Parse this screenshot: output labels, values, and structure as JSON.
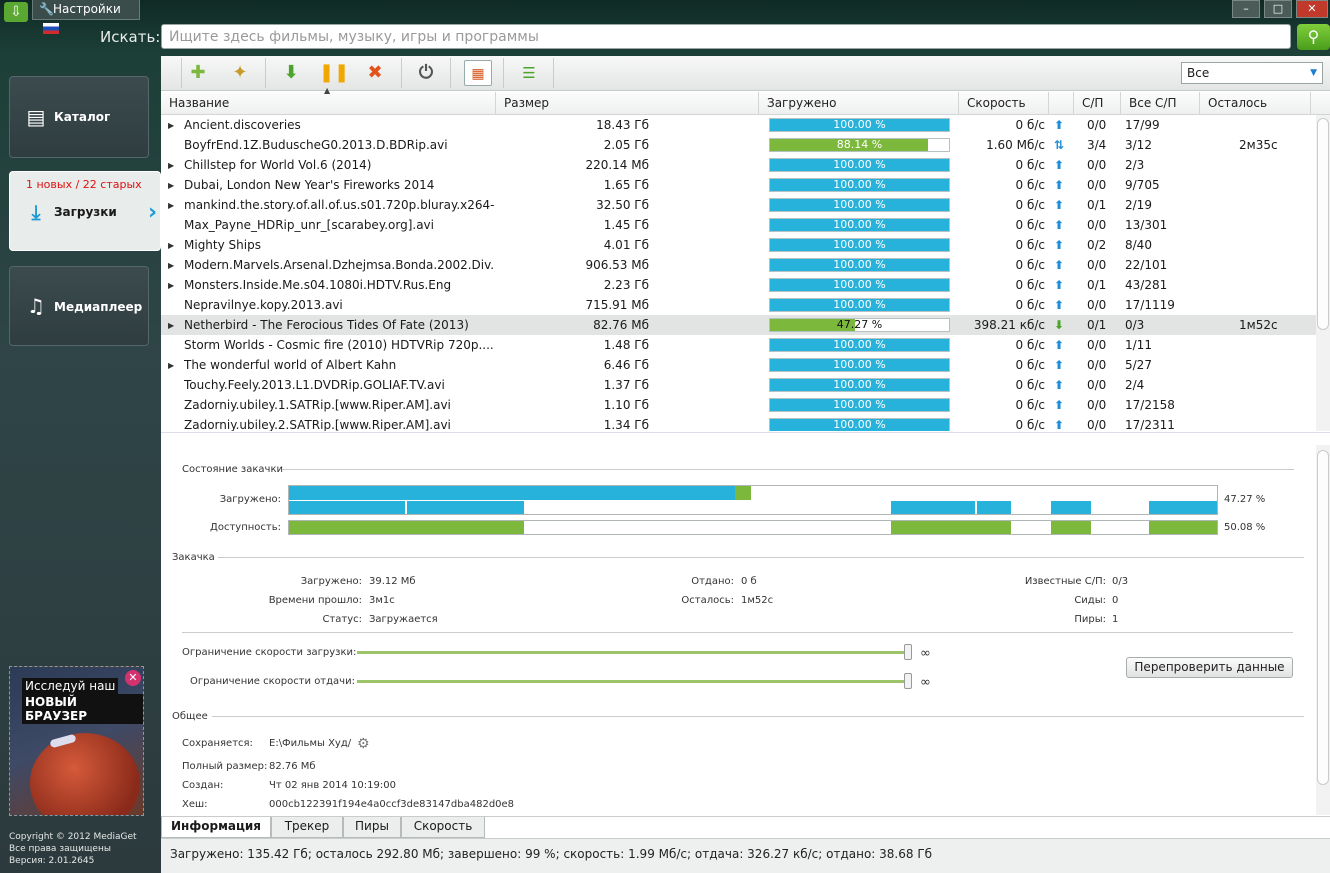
{
  "titlebar": {
    "settings_label": "Настройки",
    "minimize": "–",
    "maximize": "□",
    "close": "✕"
  },
  "search": {
    "label": "Искать:",
    "placeholder": "Ищите здесь фильмы, музыку, игры и программы"
  },
  "sidebar": {
    "catalog": "Каталог",
    "downloads": "Загрузки",
    "downloads_count": "1 новых / 22 старых",
    "media": "Медиаплеер"
  },
  "ad": {
    "line1": "Исследуй наш",
    "line2": "НОВЫЙ БРАУЗЕР"
  },
  "copyright": {
    "line1": "Copyright © 2012 MediaGet",
    "line2": "Все права защищены",
    "line3": "Версия: 2.01.2645"
  },
  "toolbar": {
    "filter_value": "Все"
  },
  "table": {
    "headers": {
      "name": "Название",
      "size": "Размер",
      "loaded": "Загружено",
      "speed": "Скорость",
      "sp": "С/П",
      "all_sp": "Все С/П",
      "remaining": "Осталось"
    },
    "rows": [
      {
        "expand": "▶",
        "name": "Ancient.discoveries",
        "size": "18.43 Гб",
        "progress": 100,
        "progress_label": "100.00 %",
        "speed": "0 б/с",
        "dir": "up",
        "sp": "0/0",
        "all_sp": "17/99",
        "remaining": ""
      },
      {
        "expand": "",
        "name": "BoyfrEnd.1Z.BuduscheG0.2013.D.BDRip.avi",
        "size": "2.05 Гб",
        "progress": 88.14,
        "progress_label": "88.14 %",
        "speed": "1.60 Мб/с",
        "dir": "both",
        "sp": "3/4",
        "all_sp": "3/12",
        "remaining": "2м35с"
      },
      {
        "expand": "▶",
        "name": "Chillstep for World Vol.6 (2014)",
        "size": "220.14 Мб",
        "progress": 100,
        "progress_label": "100.00 %",
        "speed": "0 б/с",
        "dir": "up",
        "sp": "0/0",
        "all_sp": "2/3",
        "remaining": ""
      },
      {
        "expand": "▶",
        "name": "Dubai, London New Year's Fireworks 2014",
        "size": "1.65 Гб",
        "progress": 100,
        "progress_label": "100.00 %",
        "speed": "0 б/с",
        "dir": "up",
        "sp": "0/0",
        "all_sp": "9/705",
        "remaining": ""
      },
      {
        "expand": "▶",
        "name": "mankind.the.story.of.all.of.us.s01.720p.bluray.x264-...",
        "size": "32.50 Гб",
        "progress": 100,
        "progress_label": "100.00 %",
        "speed": "0 б/с",
        "dir": "up",
        "sp": "0/1",
        "all_sp": "2/19",
        "remaining": ""
      },
      {
        "expand": "",
        "name": "Max_Payne_HDRip_unr_[scarabey.org].avi",
        "size": "1.45 Гб",
        "progress": 100,
        "progress_label": "100.00 %",
        "speed": "0 б/с",
        "dir": "up",
        "sp": "0/0",
        "all_sp": "13/301",
        "remaining": ""
      },
      {
        "expand": "▶",
        "name": "Mighty Ships",
        "size": "4.01 Гб",
        "progress": 100,
        "progress_label": "100.00 %",
        "speed": "0 б/с",
        "dir": "up",
        "sp": "0/2",
        "all_sp": "8/40",
        "remaining": ""
      },
      {
        "expand": "▶",
        "name": "Modern.Marvels.Arsenal.Dzhejmsa.Bonda.2002.Div...",
        "size": "906.53 Мб",
        "progress": 100,
        "progress_label": "100.00 %",
        "speed": "0 б/с",
        "dir": "up",
        "sp": "0/0",
        "all_sp": "22/101",
        "remaining": ""
      },
      {
        "expand": "▶",
        "name": "Monsters.Inside.Me.s04.1080i.HDTV.Rus.Eng",
        "size": "2.23 Гб",
        "progress": 100,
        "progress_label": "100.00 %",
        "speed": "0 б/с",
        "dir": "up",
        "sp": "0/1",
        "all_sp": "43/281",
        "remaining": ""
      },
      {
        "expand": "",
        "name": "Nepravilnye.kopy.2013.avi",
        "size": "715.91 Мб",
        "progress": 100,
        "progress_label": "100.00 %",
        "speed": "0 б/с",
        "dir": "up",
        "sp": "0/0",
        "all_sp": "17/1119",
        "remaining": ""
      },
      {
        "expand": "▶",
        "name": "Netherbird - The Ferocious Tides Of Fate (2013)",
        "size": "82.76 Мб",
        "progress": 47.27,
        "progress_label": "47.27 %",
        "speed": "398.21 кб/с",
        "dir": "down",
        "sp": "0/1",
        "all_sp": "0/3",
        "remaining": "1м52с",
        "selected": true
      },
      {
        "expand": "",
        "name": "Storm Worlds - Cosmic fire (2010) HDTVRip 720p....",
        "size": "1.48 Гб",
        "progress": 100,
        "progress_label": "100.00 %",
        "speed": "0 б/с",
        "dir": "up",
        "sp": "0/0",
        "all_sp": "1/11",
        "remaining": ""
      },
      {
        "expand": "▶",
        "name": "The wonderful world of Albert Kahn",
        "size": "6.46 Гб",
        "progress": 100,
        "progress_label": "100.00 %",
        "speed": "0 б/с",
        "dir": "up",
        "sp": "0/0",
        "all_sp": "5/27",
        "remaining": ""
      },
      {
        "expand": "",
        "name": "Touchy.Feely.2013.L1.DVDRip.GOLIAF.TV.avi",
        "size": "1.37 Гб",
        "progress": 100,
        "progress_label": "100.00 %",
        "speed": "0 б/с",
        "dir": "up",
        "sp": "0/0",
        "all_sp": "2/4",
        "remaining": ""
      },
      {
        "expand": "",
        "name": "Zadorniy.ubiley.1.SATRip.[www.Riper.AM].avi",
        "size": "1.10 Гб",
        "progress": 100,
        "progress_label": "100.00 %",
        "speed": "0 б/с",
        "dir": "up",
        "sp": "0/0",
        "all_sp": "17/2158",
        "remaining": ""
      },
      {
        "expand": "",
        "name": "Zadorniy.ubiley.2.SATRip.[www.Riper.AM].avi",
        "size": "1.34 Гб",
        "progress": 100,
        "progress_label": "100.00 %",
        "speed": "0 б/с",
        "dir": "up",
        "sp": "0/0",
        "all_sp": "17/2311",
        "remaining": ""
      }
    ]
  },
  "details": {
    "state_title": "Состояние закачки",
    "loaded_label": "Загружено:",
    "loaded_pct": "47.27 %",
    "avail_label": "Доступность:",
    "avail_pct": "50.08 %",
    "download_title": "Закачка",
    "dl_loaded_label": "Загружено:",
    "dl_loaded": "39.12 Мб",
    "elapsed_label": "Времени прошло:",
    "elapsed": "3м1с",
    "status_label": "Статус:",
    "status": "Загружается",
    "given_label": "Отдано:",
    "given": "0 б",
    "remaining_label": "Осталось:",
    "remaining": "1м52с",
    "known_label": "Известные С/П:",
    "known": "0/3",
    "seeds_label": "Сиды:",
    "seeds": "0",
    "peers_label": "Пиры:",
    "peers": "1",
    "dl_limit_label": "Ограничение скорости загрузки:",
    "ul_limit_label": "Ограничение скорости отдачи:",
    "infinity": "∞",
    "recheck": "Перепроверить данные",
    "general_title": "Общее",
    "saved_label": "Сохраняется:",
    "saved": "E:\\Фильмы Худ/",
    "full_size_label": "Полный размер:",
    "full_size": "82.76 Мб",
    "created_label": "Создан:",
    "created": "Чт 02 янв 2014 10:19:00",
    "hash_label": "Хеш:",
    "hash": "000cb122391f194e4a0ccf3de83147dba482d0e8"
  },
  "tabs": [
    "Информация",
    "Трекер",
    "Пиры",
    "Скорость"
  ],
  "statusbar": "Загружено: 135.42 Гб; осталось 292.80 Мб; завершено: 99 %; скорость: 1.99 Мб/с; отдача: 326.27 кб/с; отдано: 38.68 Гб",
  "colors": {
    "progress_blue": "#27b2dc",
    "progress_green": "#7cb83c",
    "accent_red": "#d11111"
  }
}
